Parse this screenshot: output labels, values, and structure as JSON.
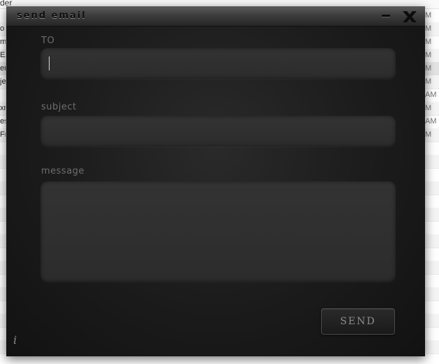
{
  "background": {
    "header_text": "der",
    "rows": [
      {
        "left": "",
        "right": "M"
      },
      {
        "left": "o",
        "right": "M"
      },
      {
        "left": "m",
        "right": "M"
      },
      {
        "left": "EA",
        "right": "M"
      },
      {
        "left": "en",
        "right": "M"
      },
      {
        "left": "je",
        "right": "M"
      },
      {
        "left": "",
        "right": "AM"
      },
      {
        "left": "xn",
        "right": "M"
      },
      {
        "left": "es",
        "right": "AM"
      },
      {
        "left": "Fr",
        "right": "M"
      },
      {
        "left": "",
        "right": ""
      },
      {
        "left": "",
        "right": ""
      },
      {
        "left": "",
        "right": ""
      },
      {
        "left": "",
        "right": ""
      },
      {
        "left": "",
        "right": ""
      },
      {
        "left": "",
        "right": ""
      },
      {
        "left": "",
        "right": ""
      },
      {
        "left": "",
        "right": ""
      },
      {
        "left": "",
        "right": ""
      },
      {
        "left": "",
        "right": ""
      },
      {
        "left": "",
        "right": ""
      },
      {
        "left": "",
        "right": ""
      },
      {
        "left": "",
        "right": ""
      },
      {
        "left": "",
        "right": ""
      },
      {
        "left": "",
        "right": ""
      },
      {
        "left": "",
        "right": ""
      }
    ]
  },
  "dialog": {
    "title": "send email",
    "minimize_icon": "minimize-icon",
    "close_icon": "close-icon",
    "to": {
      "label": "TO",
      "value": "",
      "placeholder": ""
    },
    "subject": {
      "label": "subject",
      "value": "",
      "placeholder": ""
    },
    "message": {
      "label": "message",
      "value": "",
      "placeholder": ""
    },
    "send_label": "SEND",
    "info_icon": "info-icon"
  },
  "colors": {
    "dialog_bg": "#1b1b1b",
    "field_bg": "#303030",
    "label": "#6e6e6e",
    "button_text": "#8d8d8d"
  }
}
